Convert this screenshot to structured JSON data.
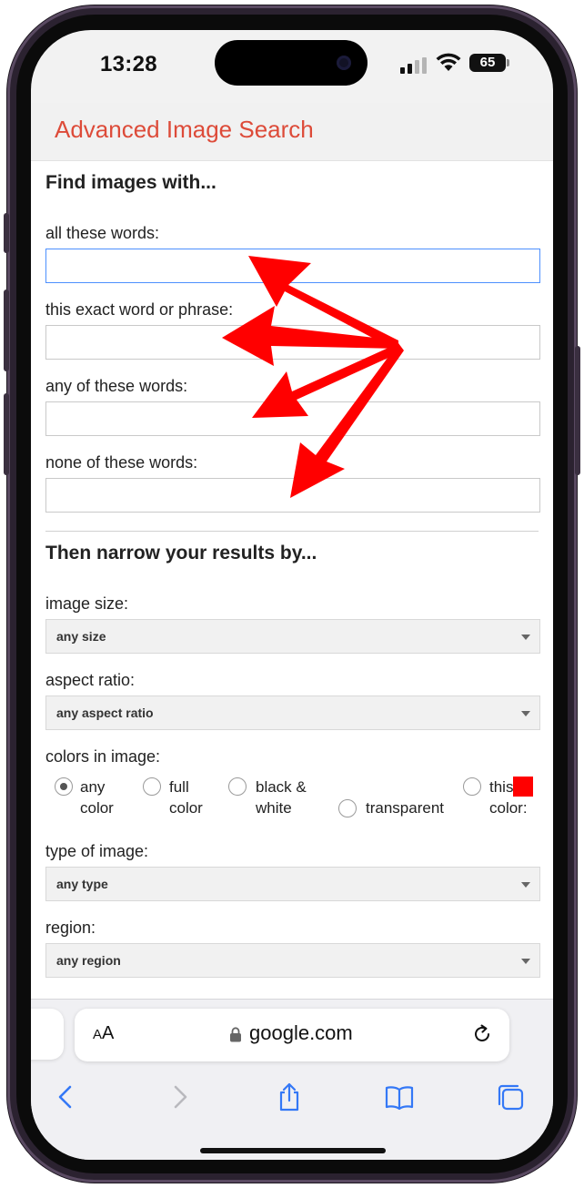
{
  "status_bar": {
    "time": "13:28",
    "battery": "65"
  },
  "page": {
    "title": "Advanced Image Search",
    "find_section_title": "Find images with...",
    "fields": [
      {
        "label": "all these words:",
        "value": ""
      },
      {
        "label": "this exact word or phrase:",
        "value": ""
      },
      {
        "label": "any of these words:",
        "value": ""
      },
      {
        "label": "none of these words:",
        "value": ""
      }
    ],
    "narrow_section_title": "Then narrow your results by...",
    "image_size": {
      "label": "image size:",
      "selected": "any size"
    },
    "aspect_ratio": {
      "label": "aspect ratio:",
      "selected": "any aspect ratio"
    },
    "colors": {
      "label": "colors in image:",
      "options": [
        {
          "line1": "any",
          "line2": "color",
          "checked": true
        },
        {
          "line1": "full",
          "line2": "color",
          "checked": false
        },
        {
          "line1": "black &",
          "line2": "white",
          "checked": false
        },
        {
          "line1": "transparent",
          "line2": "",
          "checked": false
        },
        {
          "line1": "this",
          "line2": "color:",
          "checked": false
        }
      ],
      "swatch_color": "#ff0000"
    },
    "type_of_image": {
      "label": "type of image:",
      "selected": "any type"
    },
    "region": {
      "label": "region:",
      "selected": "any region"
    },
    "accent_color": "#dd4b39",
    "focus_color": "#4d90fe"
  },
  "browser": {
    "text_size_label_small": "A",
    "text_size_label_large": "A",
    "url": "google.com",
    "icons": [
      "lock-icon",
      "reload-icon",
      "back-icon",
      "forward-icon",
      "share-icon",
      "bookmarks-icon",
      "tabs-icon"
    ],
    "tint_color": "#3478f6"
  },
  "annotation": {
    "arrow_color": "#ff0000"
  }
}
